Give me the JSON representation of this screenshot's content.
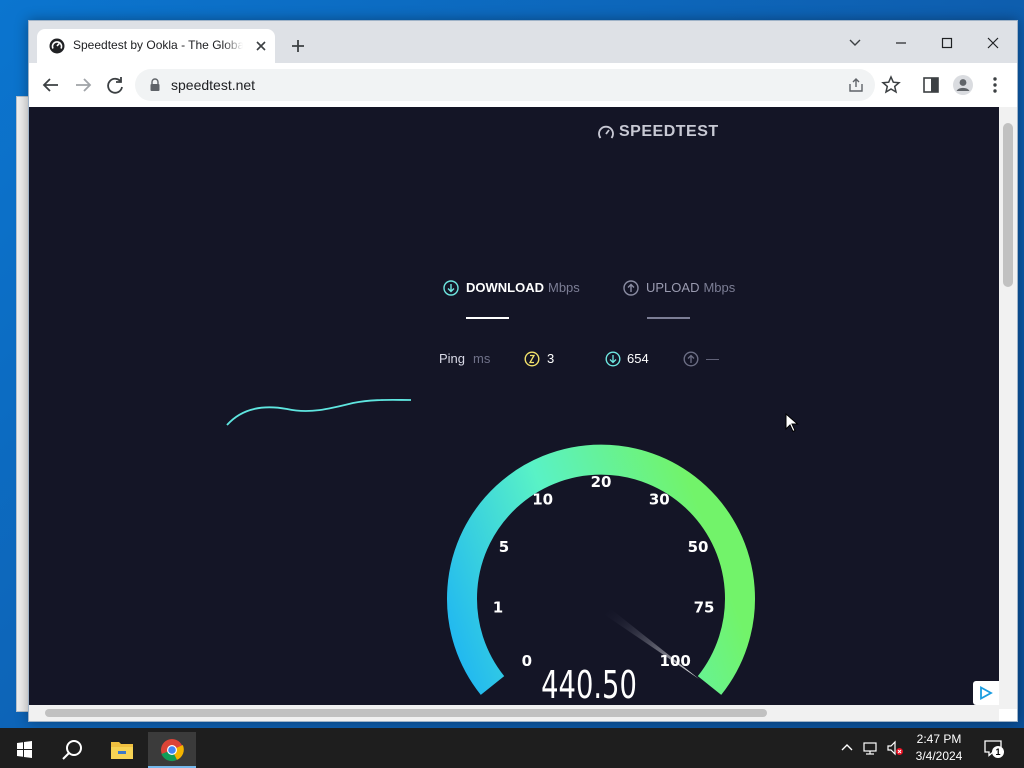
{
  "browser": {
    "tab": {
      "title": "Speedtest by Ookla - The Global Broadband Speed Test",
      "favicon": "speedtest-icon"
    },
    "url": "speedtest.net"
  },
  "page": {
    "brand": "SPEEDTEST",
    "download": {
      "label": "DOWNLOAD",
      "unit": "Mbps"
    },
    "upload": {
      "label": "UPLOAD",
      "unit": "Mbps"
    },
    "ping": {
      "label": "Ping",
      "unit": "ms",
      "value": "3",
      "download_value": "654",
      "upload_value": "—"
    },
    "gauge": {
      "scale_labels": [
        "0",
        "1",
        "5",
        "10",
        "20",
        "30",
        "50",
        "75",
        "100"
      ],
      "current_value": "440.50",
      "colors": {
        "start": "#1fb6f2",
        "mid": "#59f2c6",
        "end": "#72f36a"
      }
    }
  },
  "taskbar": {
    "time": "2:47 PM",
    "date": "3/4/2024",
    "notification_count": "1"
  },
  "colors": {
    "page_bg": "#141526",
    "accent": "#6ee7e0",
    "desktop": "#0b75cf"
  }
}
